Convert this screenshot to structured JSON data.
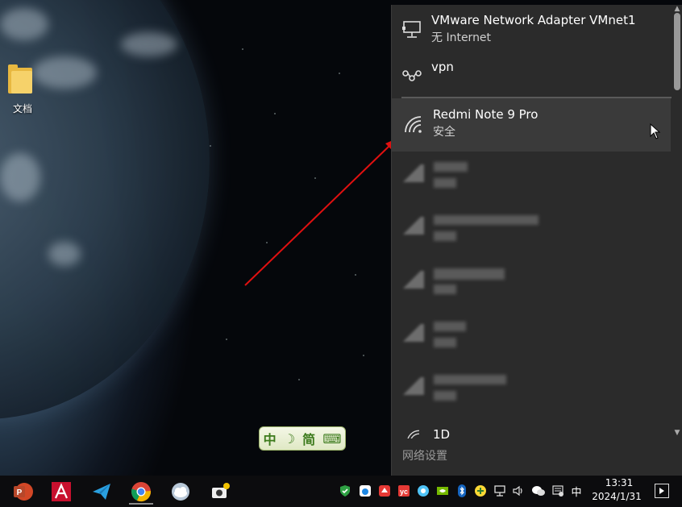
{
  "desktop": {
    "folder_label": "文档",
    "ime_bar": {
      "lang": "中",
      "moon": "☽",
      "mode": "简",
      "keyboard": "⌨"
    }
  },
  "network_flyout": {
    "items": [
      {
        "name": "VMware Network Adapter VMnet1",
        "status": "无 Internet",
        "icon": "ethernet-icon"
      },
      {
        "name": "vpn",
        "status": "",
        "icon": "vpn-icon"
      },
      {
        "name": "Redmi Note 9 Pro",
        "status": "安全",
        "icon": "wifi-icon",
        "hovered": true
      },
      {
        "name": "1D",
        "status": "",
        "icon": "wifi-icon"
      }
    ],
    "hidden_networks_count": 5,
    "settings_link": "网络设置"
  },
  "taskbar": {
    "apps": [
      {
        "name": "powerpoint",
        "icon": "powerpoint-icon"
      },
      {
        "name": "autocad",
        "icon": "autocad-icon"
      },
      {
        "name": "telegram",
        "icon": "telegram-icon"
      },
      {
        "name": "chrome",
        "icon": "chrome-icon",
        "active": true
      },
      {
        "name": "cloud-app",
        "icon": "cloud-app-icon"
      },
      {
        "name": "camera-app",
        "icon": "camera-app-icon"
      }
    ],
    "tray": {
      "ime_indicator": "中",
      "time": "13:31",
      "date": "2024/1/31"
    }
  },
  "colors": {
    "flyout_bg": "#2b2b2b",
    "hover_bg": "#3a3a3a",
    "arrow": "#e01010",
    "taskbar_bg": "#0c0c0e"
  }
}
